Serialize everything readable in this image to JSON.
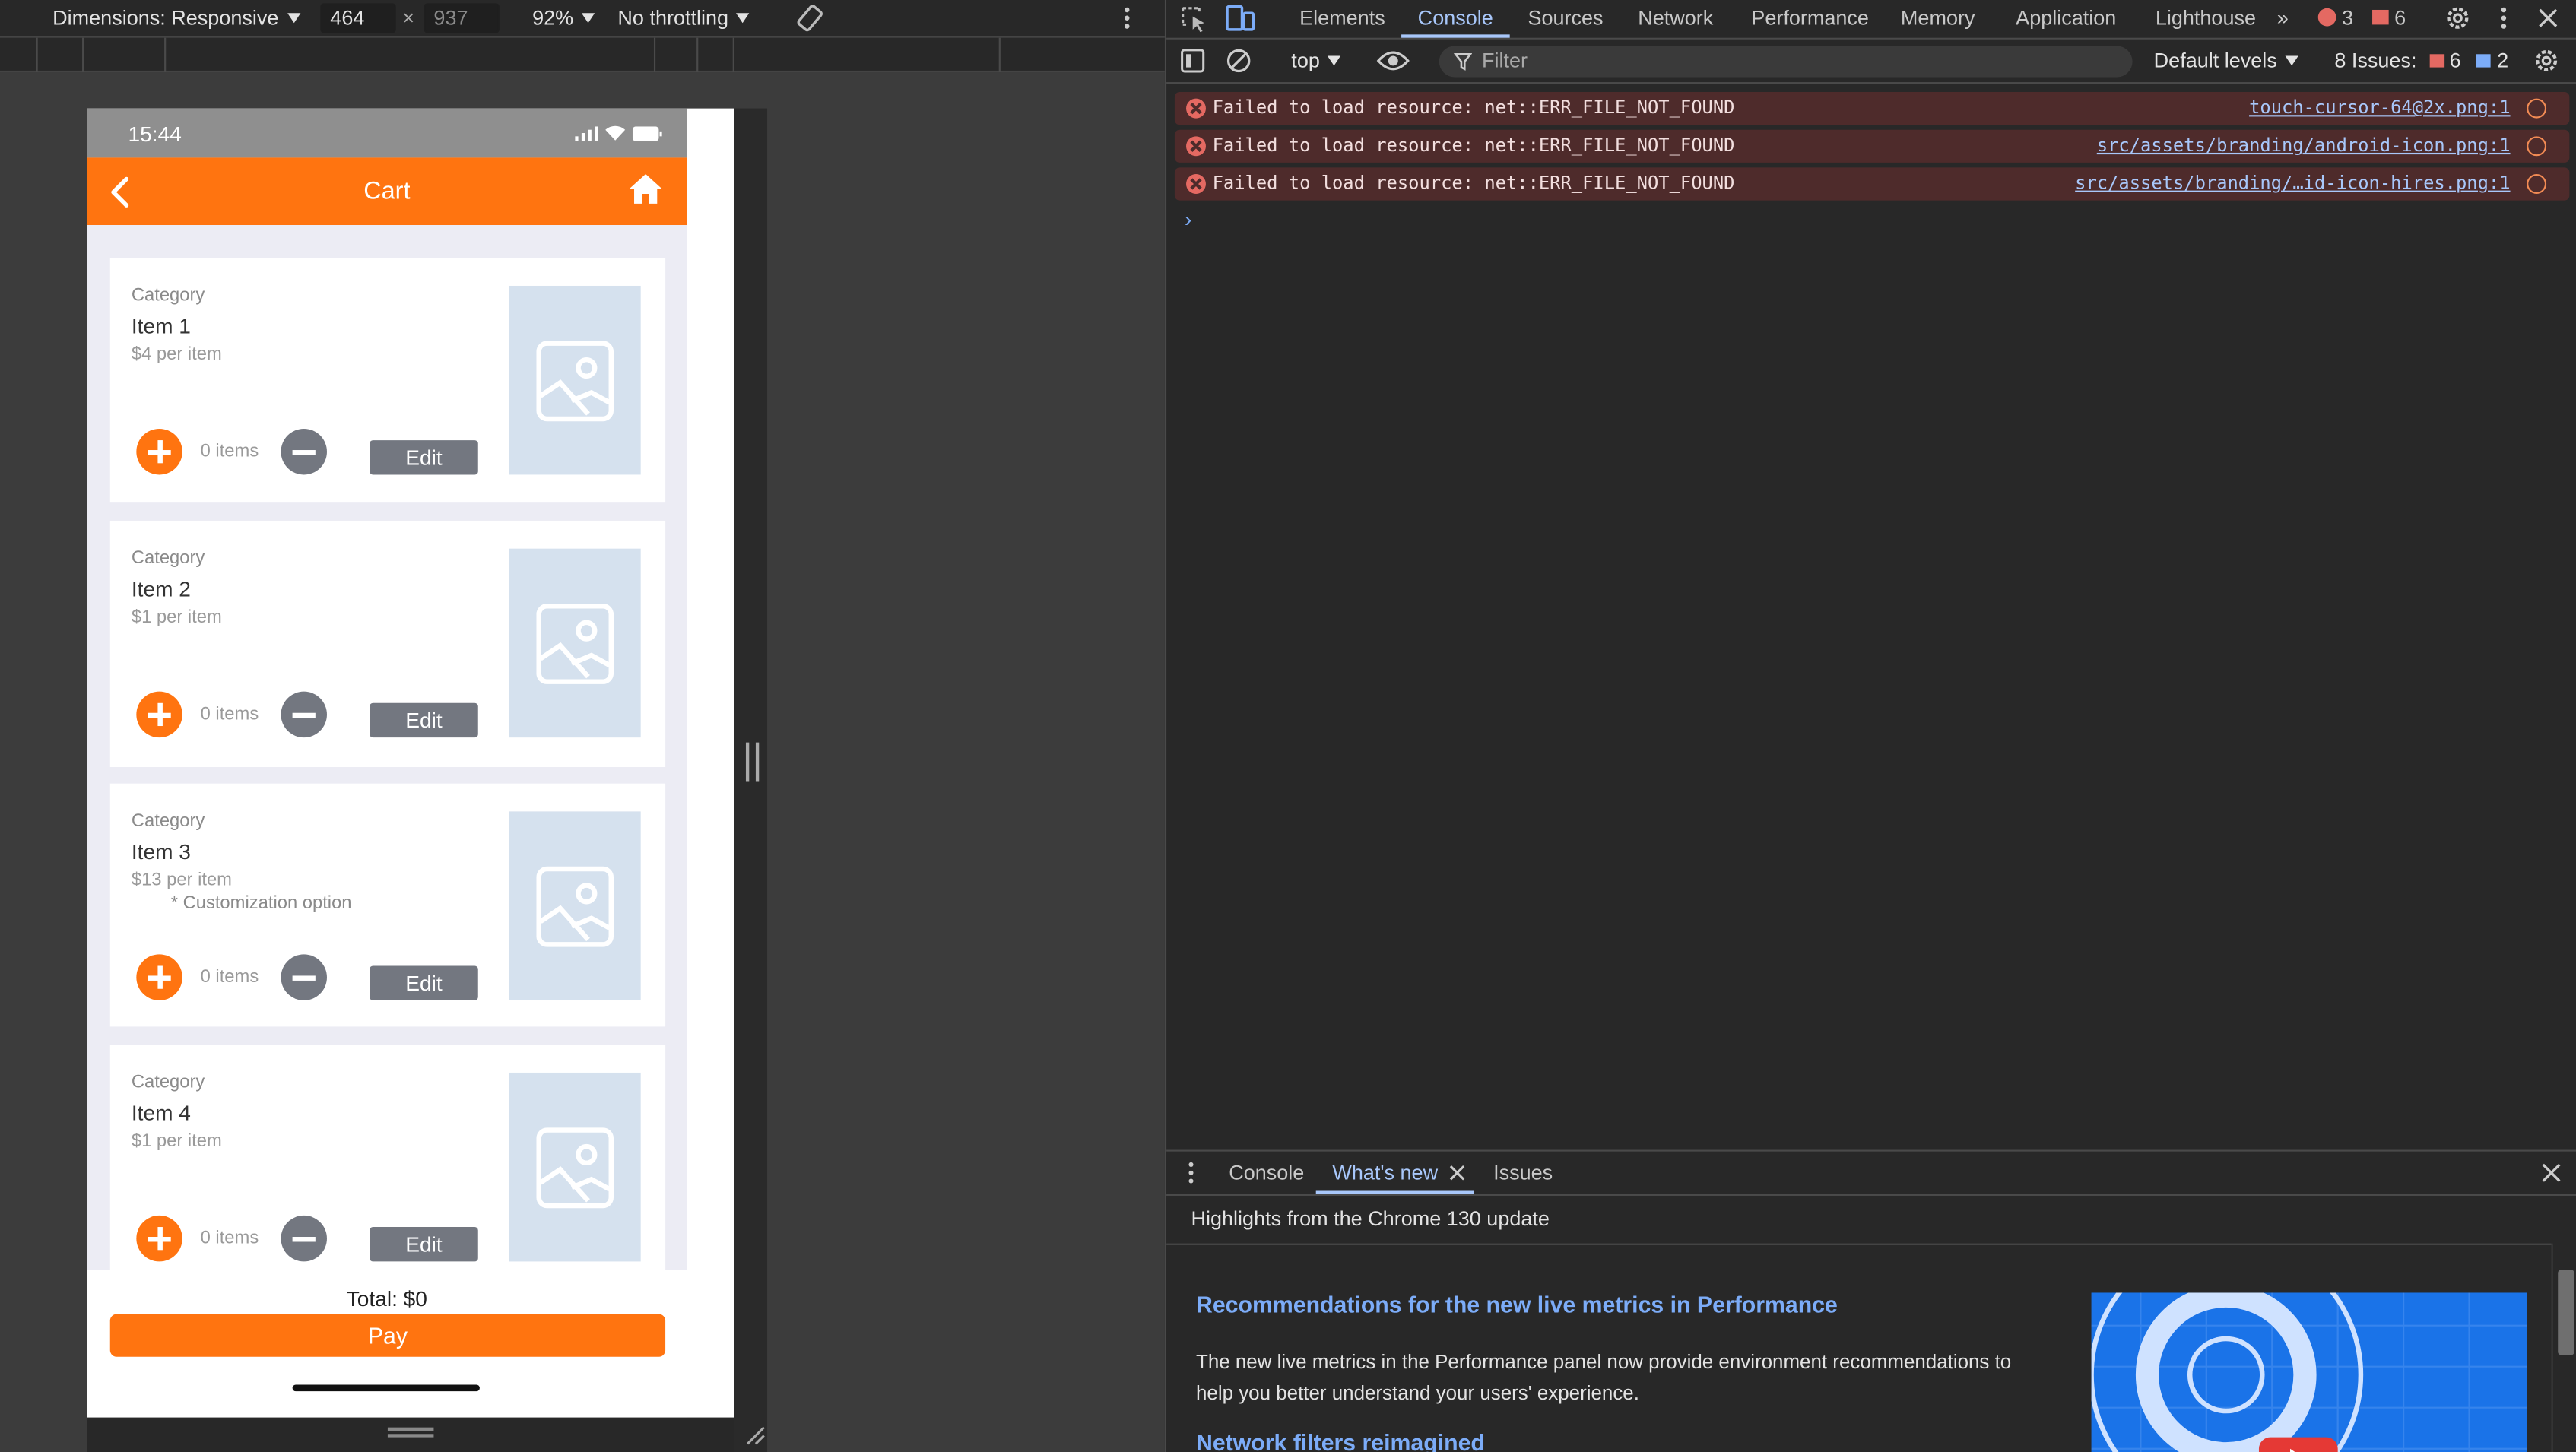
{
  "device_toolbar": {
    "dimensions_label": "Dimensions: Responsive",
    "width_value": "464",
    "height_value": "937",
    "zoom": "92%",
    "throttling": "No throttling"
  },
  "phone": {
    "status_time": "15:44",
    "appbar_title": "Cart",
    "cards": [
      {
        "category": "Category",
        "name": "Item 1",
        "price": "$4 per item",
        "option": "",
        "qty": "0 items",
        "edit": "Edit"
      },
      {
        "category": "Category",
        "name": "Item 2",
        "price": "$1 per item",
        "option": "",
        "qty": "0 items",
        "edit": "Edit"
      },
      {
        "category": "Category",
        "name": "Item 3",
        "price": "$13 per item",
        "option": "* Customization option",
        "qty": "0 items",
        "edit": "Edit"
      },
      {
        "category": "Category",
        "name": "Item 4",
        "price": "$1 per item",
        "option": "",
        "qty": "0 items",
        "edit": "Edit"
      }
    ],
    "total": "Total: $0",
    "pay": "Pay"
  },
  "devtools": {
    "tabs": [
      "Elements",
      "Console",
      "Sources",
      "Network",
      "Performance",
      "Memory",
      "Application",
      "Lighthouse"
    ],
    "active_tab": "Console",
    "error_count": "3",
    "issue_badge_count": "6",
    "context": "top",
    "filter_placeholder": "Filter",
    "levels": "Default levels",
    "issues_label": "8 Issues:",
    "issues_error": "6",
    "issues_info": "2",
    "messages": [
      {
        "text": "Failed to load resource: net::ERR_FILE_NOT_FOUND",
        "source": "touch-cursor-64@2x.png:1"
      },
      {
        "text": "Failed to load resource: net::ERR_FILE_NOT_FOUND",
        "source": "src/assets/branding/android-icon.png:1"
      },
      {
        "text": "Failed to load resource: net::ERR_FILE_NOT_FOUND",
        "source": "src/assets/branding/…id-icon-hires.png:1"
      }
    ],
    "drawer": {
      "tabs": [
        "Console",
        "What's new",
        "Issues"
      ],
      "active": "What's new",
      "highlights": "Highlights from the Chrome 130 update",
      "heading1": "Recommendations for the new live metrics in Performance",
      "paragraph": "The new live metrics in the Performance panel now provide environment recommendations to help you better understand your users' experience.",
      "heading2": "Network filters reimagined"
    }
  },
  "colors": {
    "brand_orange": "#ff7410",
    "devtools_bg": "#282828",
    "link_blue": "#a8c7fa",
    "error_bg": "#4e2b2b"
  }
}
